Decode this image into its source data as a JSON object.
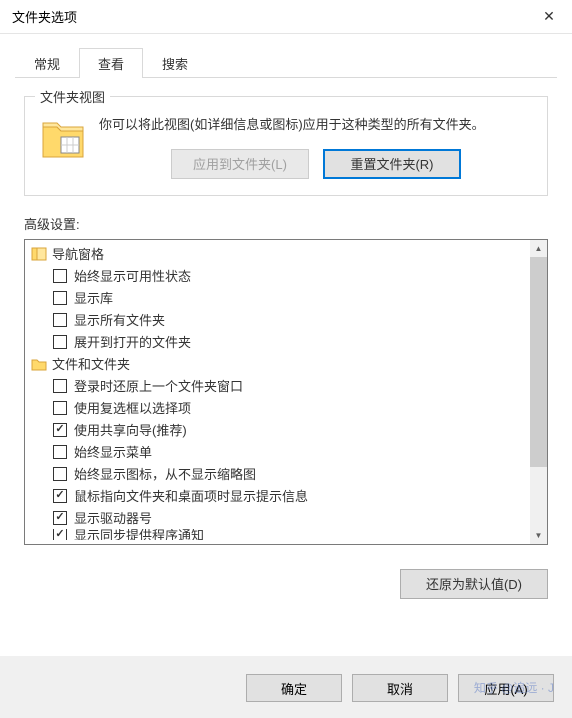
{
  "titlebar": {
    "title": "文件夹选项",
    "close": "✕"
  },
  "tabs": {
    "general": "常规",
    "view": "查看",
    "search": "搜索"
  },
  "folderViews": {
    "title": "文件夹视图",
    "description": "你可以将此视图(如详细信息或图标)应用于这种类型的所有文件夹。",
    "applyButton": "应用到文件夹(L)",
    "resetButton": "重置文件夹(R)"
  },
  "advanced": {
    "label": "高级设置:",
    "navPane": "导航窗格",
    "filesAndFolders": "文件和文件夹",
    "items": {
      "showAvailability": "始终显示可用性状态",
      "showLibraries": "显示库",
      "showAllFolders": "显示所有文件夹",
      "expandToOpen": "展开到打开的文件夹",
      "restoreWindows": "登录时还原上一个文件夹窗口",
      "useCheckboxes": "使用复选框以选择项",
      "useSharingWizard": "使用共享向导(推荐)",
      "alwaysShowMenus": "始终显示菜单",
      "alwaysShowIcons": "始终显示图标，从不显示缩略图",
      "showTooltips": "鼠标指向文件夹和桌面项时显示提示信息",
      "showDriveLetters": "显示驱动器号",
      "partial": "显示同步提供程序通知"
    }
  },
  "restoreDefaults": "还原为默认值(D)",
  "dialogButtons": {
    "ok": "确定",
    "cancel": "取消",
    "apply": "应用(A)"
  },
  "watermark": "知乎 @追远 · J"
}
